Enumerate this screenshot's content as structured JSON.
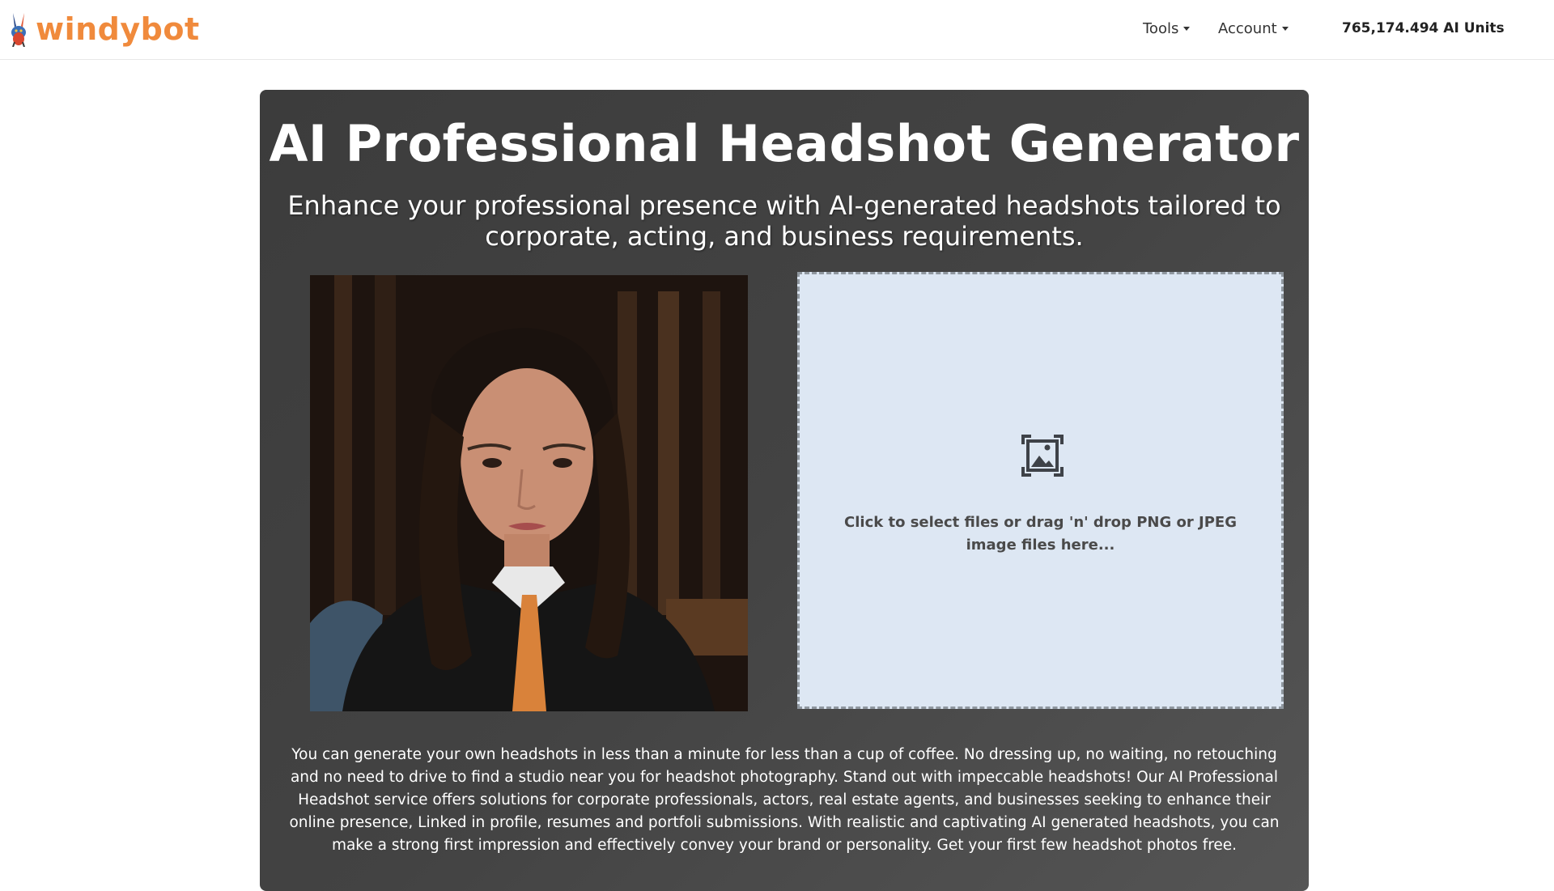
{
  "brand": {
    "name": "windybot",
    "color": "#f08a3c"
  },
  "nav": {
    "tools_label": "Tools",
    "account_label": "Account",
    "units_label": "765,174.494 AI Units"
  },
  "hero": {
    "title": "AI Professional Headshot Generator",
    "subtitle": "Enhance your professional presence with AI-generated headshots tailored to corporate, acting, and business requirements."
  },
  "example_photo": {
    "icon": "headshot-example-image"
  },
  "upload": {
    "icon": "image-upload-icon",
    "text": "Click to select files or drag 'n' drop PNG or JPEG image files here..."
  },
  "description": "You can generate your own headshots in less than a minute for less than a cup of coffee. No dressing up, no waiting, no retouching and no need to drive to find a studio near you for headshot photography. Stand out with impeccable headshots! Our AI Professional Headshot service offers solutions for corporate professionals, actors, real estate agents, and businesses seeking to enhance their online presence, Linked in profile, resumes and portfoli submissions. With realistic and captivating AI generated headshots, you can make a strong first impression and effectively convey your brand or personality. Get your first few headshot photos free."
}
